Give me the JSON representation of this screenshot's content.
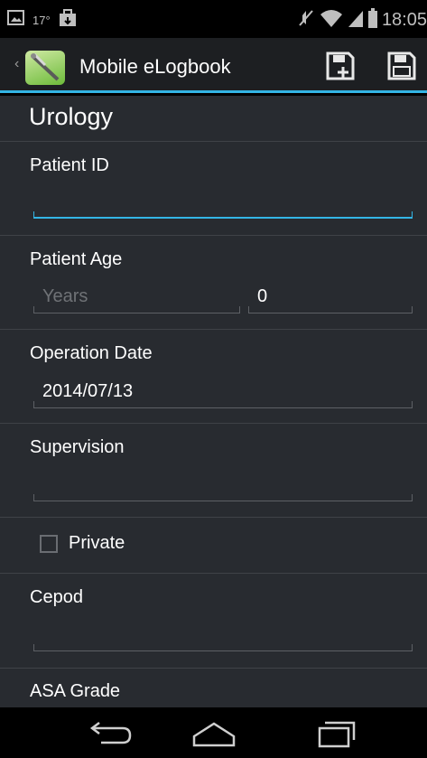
{
  "status_bar": {
    "temperature": "17°",
    "time": "18:05"
  },
  "action_bar": {
    "title": "Mobile eLogbook"
  },
  "form": {
    "section_title": "Urology",
    "patient_id": {
      "label": "Patient ID",
      "value": ""
    },
    "patient_age": {
      "label": "Patient Age",
      "years_placeholder": "Years",
      "months_value": "0"
    },
    "operation_date": {
      "label": "Operation Date",
      "value": "2014/07/13"
    },
    "supervision": {
      "label": "Supervision",
      "value": ""
    },
    "private": {
      "label": "Private",
      "checked": false
    },
    "cepod": {
      "label": "Cepod",
      "value": ""
    },
    "asa_grade": {
      "label": "ASA Grade"
    }
  },
  "colors": {
    "accent": "#33b5e5",
    "background": "#282b30",
    "action_bar": "#1d1f22"
  },
  "icons": {
    "status": [
      "screenshot-icon",
      "bag-icon",
      "mute-icon",
      "wifi-icon",
      "signal-icon",
      "battery-icon"
    ],
    "action": [
      "save-new-icon",
      "save-icon"
    ],
    "nav": [
      "back-icon",
      "home-icon",
      "recents-icon"
    ]
  }
}
